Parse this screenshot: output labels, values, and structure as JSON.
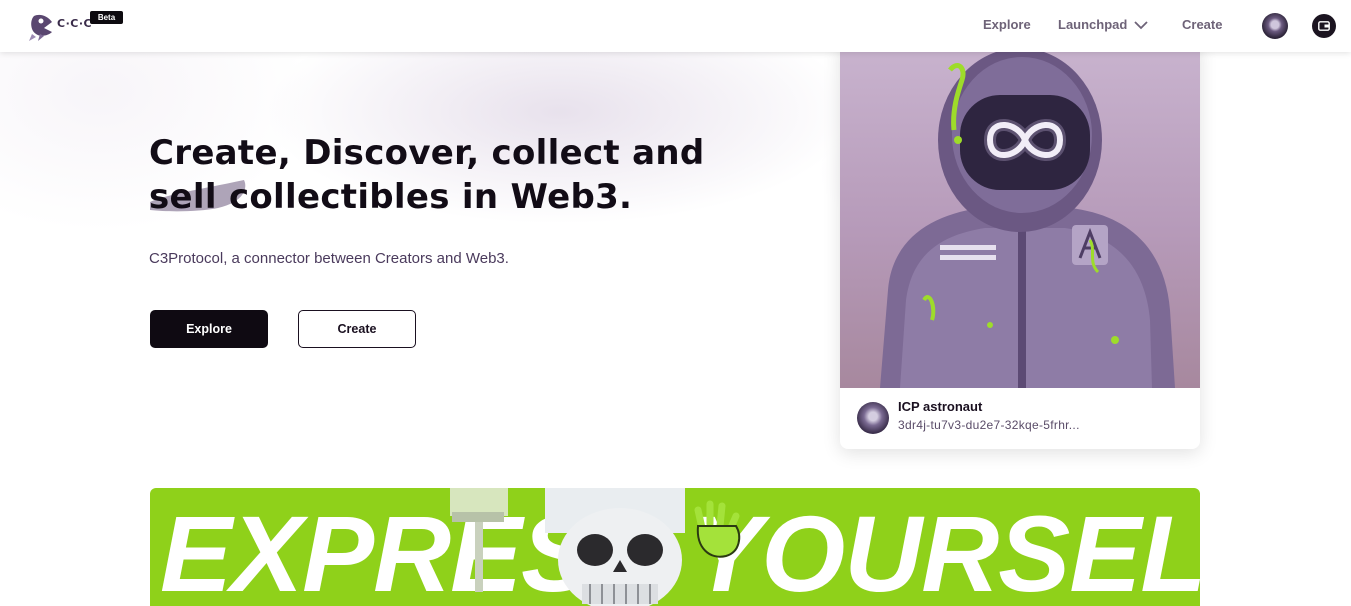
{
  "header": {
    "logo_text": "C·C·C",
    "beta_label": "Beta",
    "nav": {
      "explore": "Explore",
      "launchpad": "Launchpad",
      "create": "Create"
    }
  },
  "hero": {
    "title_line1": "Create, Discover, collect and",
    "title_line2": "sell collectibles in Web3.",
    "subtitle": "C3Protocol, a connector between Creators and Web3.",
    "explore_button": "Explore",
    "create_button": "Create"
  },
  "featured_card": {
    "name": "ICP astronaut",
    "owner_id": "3dr4j-tu7v3-du2e7-32kqe-5frhr..."
  },
  "banner": {
    "text": "EXPRESS YOURSELF!"
  },
  "colors": {
    "banner_green": "#8fd11a",
    "primary_dark": "#0f0a12",
    "nav_text": "#6e6378"
  }
}
